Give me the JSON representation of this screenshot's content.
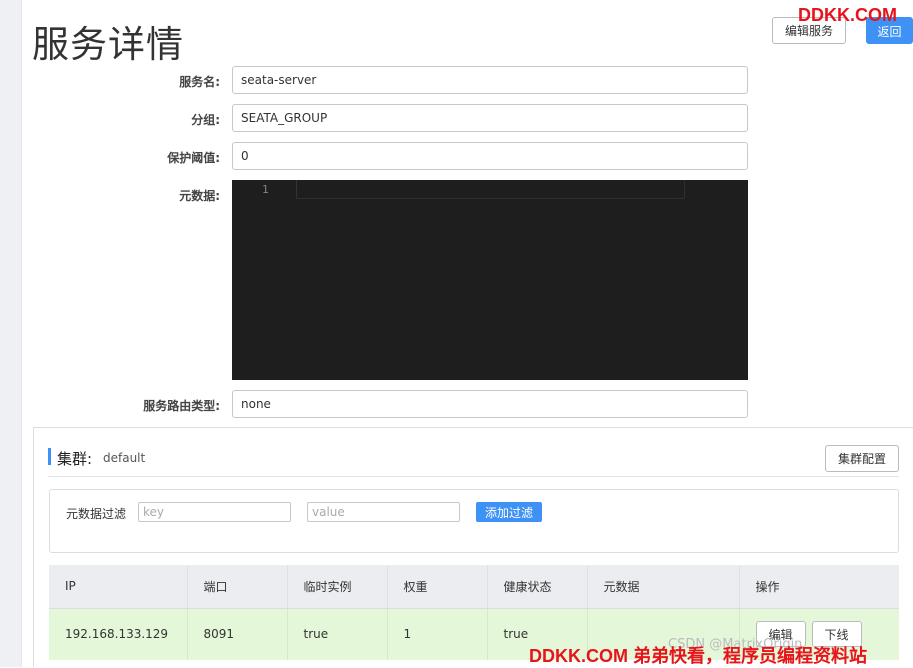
{
  "page": {
    "title": "服务详情",
    "edit_service_label": "编辑服务",
    "back_label": "返回"
  },
  "watermark": {
    "top": "DDKK.COM",
    "bottom": "DDKK.COM 弟弟快看，程序员编程资料站",
    "csdn": "CSDN @MatrixOrigin"
  },
  "form": {
    "service_name_label": "服务名:",
    "service_name_value": "seata-server",
    "group_label": "分组:",
    "group_value": "SEATA_GROUP",
    "protect_threshold_label": "保护阈值:",
    "protect_threshold_value": "0",
    "metadata_label": "元数据:",
    "metadata_line_number": "1",
    "route_type_label": "服务路由类型:",
    "route_type_value": "none"
  },
  "cluster": {
    "title": "集群:",
    "name": "default",
    "config_label": "集群配置",
    "filter": {
      "label": "元数据过滤",
      "key_placeholder": "key",
      "value_placeholder": "value",
      "add_label": "添加过滤"
    },
    "table": {
      "headers": [
        "IP",
        "端口",
        "临时实例",
        "权重",
        "健康状态",
        "元数据",
        "操作"
      ],
      "rows": [
        {
          "ip": "192.168.133.129",
          "port": "8091",
          "ephemeral": "true",
          "weight": "1",
          "healthy": "true",
          "metadata": "",
          "edit_label": "编辑",
          "offline_label": "下线"
        }
      ]
    }
  },
  "colors": {
    "accent": "#3e92f5",
    "row_bg": "#e5f7d9",
    "editor_bg": "#1e1e1e",
    "watermark": "#e8141b"
  }
}
